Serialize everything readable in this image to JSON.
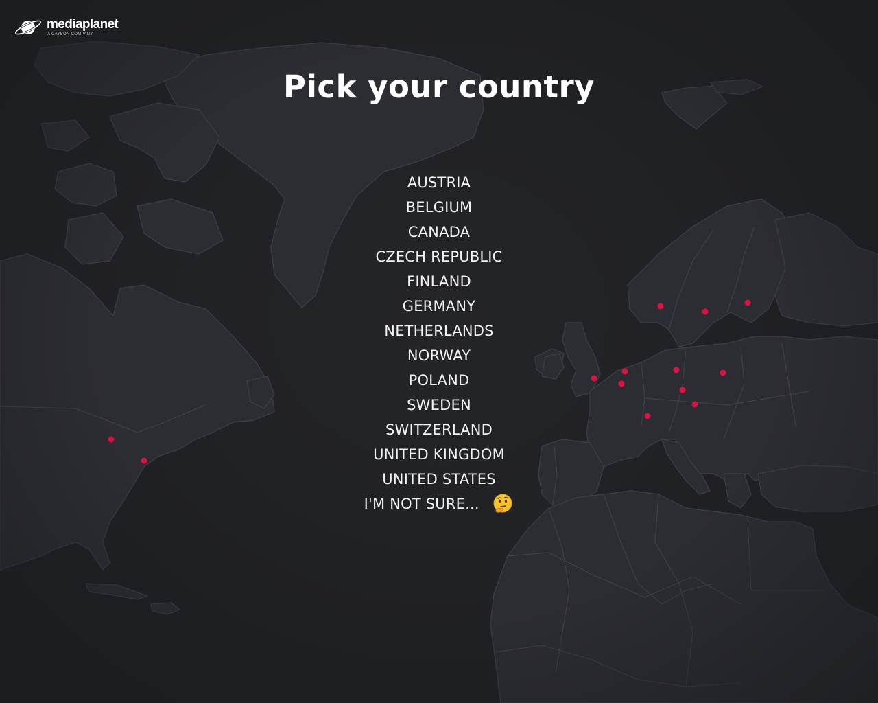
{
  "brand": {
    "name": "mediaplanet",
    "tagline": "A CAYBON COMPANY"
  },
  "page": {
    "title": "Pick your country"
  },
  "countries": [
    {
      "label": "AUSTRIA"
    },
    {
      "label": "BELGIUM"
    },
    {
      "label": "CANADA"
    },
    {
      "label": "CZECH REPUBLIC"
    },
    {
      "label": "FINLAND"
    },
    {
      "label": "GERMANY"
    },
    {
      "label": "NETHERLANDS"
    },
    {
      "label": "NORWAY"
    },
    {
      "label": "POLAND"
    },
    {
      "label": "SWEDEN"
    },
    {
      "label": "SWITZERLAND"
    },
    {
      "label": "UNITED KINGDOM"
    },
    {
      "label": "UNITED STATES"
    }
  ],
  "not_sure": {
    "label": "I'M NOT SURE...",
    "icon": "thinking-face-icon"
  },
  "colors": {
    "background": "#1f2024",
    "land": "#2c2d32",
    "pin": "#e0103f",
    "text": "#ffffff"
  }
}
